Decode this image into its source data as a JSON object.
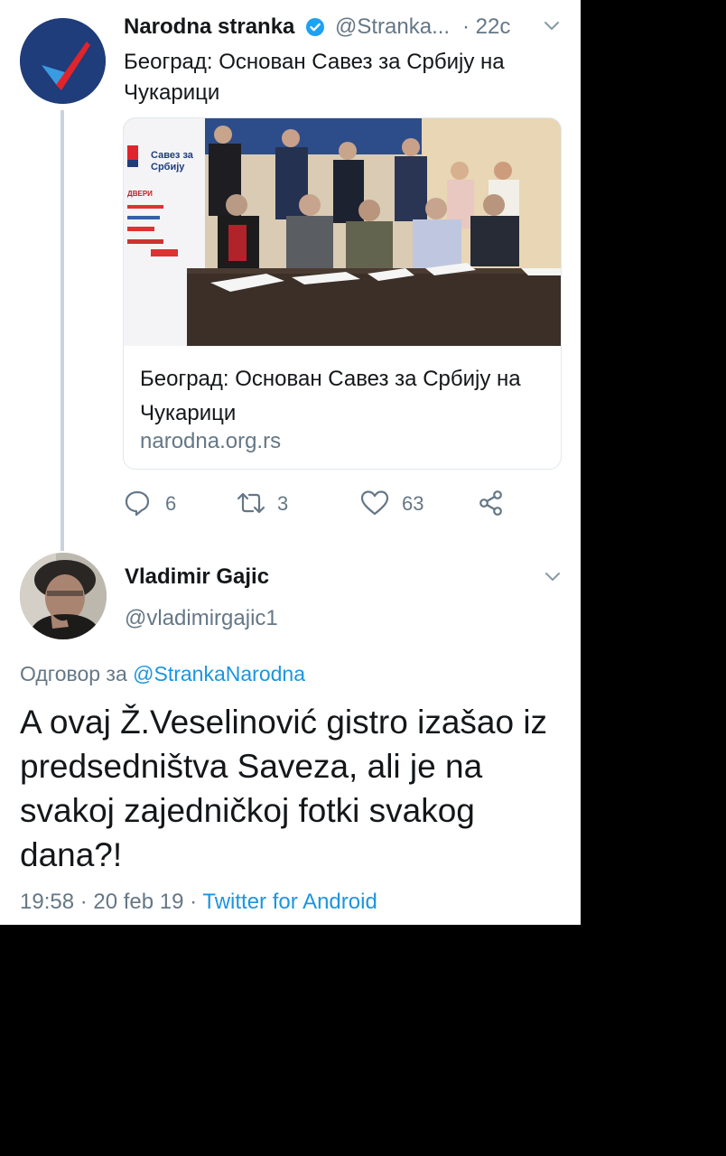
{
  "original_tweet": {
    "author_name": "Narodna stranka",
    "author_handle": "@Stranka...",
    "time": "· 22с",
    "text": "Београд: Основан Савез за Србију на Чукарици",
    "verified": true,
    "link_card": {
      "title": "Београд: Основан Савез за Србију на Чукарици",
      "domain": "narodna.org.rs",
      "banner_text": {
        "line1": "Савез за",
        "line2": "Србију",
        "dveri": "ДВЕРИ"
      }
    },
    "actions": {
      "replies": "6",
      "retweets": "3",
      "likes": "63"
    }
  },
  "reply_tweet": {
    "author_name": "Vladimir Gajic",
    "author_handle": "@vladimirgajic1",
    "reply_prefix": "Одговор за",
    "reply_to_handle": "@StrankaNarodna",
    "text": "A ovaj Ž.Veselinović gistro izašao iz predsedništva Saveza, ali je na svakoj zajedničkoj fotki svakog dana?!",
    "timestamp": "19:58 · 20 feb 19 · ",
    "source": "Twitter for Android"
  },
  "colors": {
    "link": "#1b95e0",
    "secondary_text": "#657786",
    "primary_text": "#14171a",
    "thread_line": "#c9d3dc",
    "brand_blue": "#1f3c7b",
    "brand_red": "#e0242b"
  }
}
